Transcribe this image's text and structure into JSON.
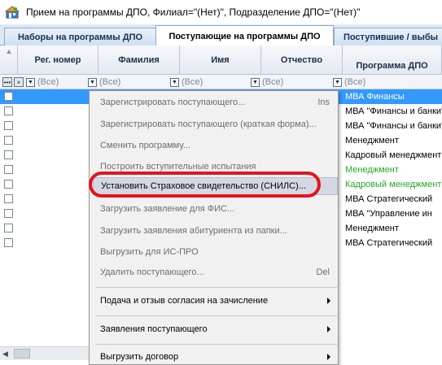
{
  "window": {
    "title": "Прием на программы ДПО, Филиал=\"(Нет)\", Подразделение ДПО=\"(Нет)\""
  },
  "tabs": [
    {
      "label": "Наборы на программы ДПО",
      "active": false
    },
    {
      "label": "Поступающие на программы ДПО",
      "active": true
    },
    {
      "label": "Поступившие / выбы",
      "active": false
    }
  ],
  "grid": {
    "columns": [
      "Рег. номер",
      "Фамилия",
      "Имя",
      "Отчество",
      "Программа ДПО"
    ],
    "filter_placeholder": "(Все)",
    "rows": [
      {
        "program": "МВА Финансы",
        "selected": true,
        "color": "#ffffff"
      },
      {
        "program": "МВА \"Финансы и банки\"",
        "selected": false,
        "color": "#000000"
      },
      {
        "program": "МВА \"Финансы и банки\"",
        "selected": false,
        "color": "#000000"
      },
      {
        "program": "Менеджмент",
        "selected": false,
        "color": "#000000"
      },
      {
        "program": "Кадровый менеджмент",
        "selected": false,
        "color": "#000000"
      },
      {
        "program": "Менеджмент",
        "selected": false,
        "color": "#22aa22"
      },
      {
        "program": "Кадровый менеджмент",
        "selected": false,
        "color": "#22aa22"
      },
      {
        "program": "МВА Стратегический",
        "selected": false,
        "color": "#000000"
      },
      {
        "program": "МВА \"Управление ин",
        "selected": false,
        "color": "#000000"
      },
      {
        "program": "Менеджмент",
        "selected": false,
        "color": "#000000"
      },
      {
        "program": "МВА Стратегический",
        "selected": false,
        "color": "#000000"
      }
    ]
  },
  "context_menu": {
    "items": [
      {
        "label": "Зарегистрировать поступающего...",
        "shortcut": "Ins",
        "enabled": false,
        "submenu": false
      },
      {
        "label": "Зарегистрировать поступающего (краткая форма)...",
        "shortcut": "",
        "enabled": false,
        "submenu": false
      },
      {
        "label": "Сменить программу...",
        "shortcut": "",
        "enabled": false,
        "submenu": false
      },
      {
        "label": "Построить вступительные испытания",
        "shortcut": "",
        "enabled": false,
        "submenu": false
      },
      {
        "label": "Установить Страховое свидетельство (СНИЛС)...",
        "shortcut": "",
        "enabled": true,
        "submenu": false,
        "hover": true
      },
      {
        "label": "Загрузить заявление для ФИС...",
        "shortcut": "",
        "enabled": false,
        "submenu": false
      },
      {
        "label": "Загрузить заявления абитуриента из папки...",
        "shortcut": "",
        "enabled": false,
        "submenu": false
      },
      {
        "label": "Выгрузить для ИС-ПРО",
        "shortcut": "",
        "enabled": false,
        "submenu": false
      },
      {
        "label": "Удалить поступающего...",
        "shortcut": "Del",
        "enabled": false,
        "submenu": false
      },
      {
        "label": "Подача и отзыв согласия на зачисление",
        "shortcut": "",
        "enabled": true,
        "submenu": true
      },
      {
        "label": "Заявления поступающего",
        "shortcut": "",
        "enabled": true,
        "submenu": true
      },
      {
        "label": "Выгрузить договор",
        "shortcut": "",
        "enabled": true,
        "submenu": true
      }
    ]
  },
  "colors": {
    "selection": "#3399ff",
    "annotation": "#e4151d",
    "green_text": "#22aa22"
  }
}
